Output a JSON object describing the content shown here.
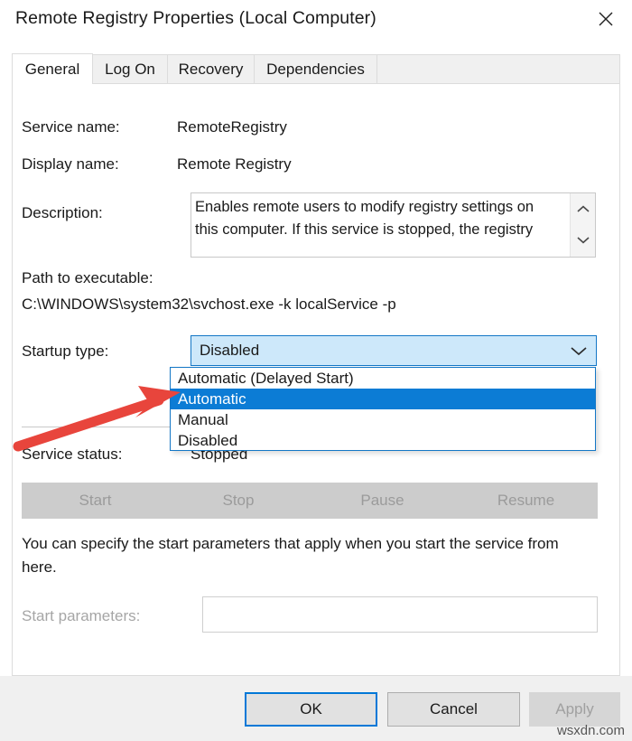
{
  "window": {
    "title": "Remote Registry Properties (Local Computer)",
    "close_icon": "close-icon"
  },
  "tabs": [
    {
      "label": "General",
      "active": true
    },
    {
      "label": "Log On",
      "active": false
    },
    {
      "label": "Recovery",
      "active": false
    },
    {
      "label": "Dependencies",
      "active": false
    }
  ],
  "general": {
    "service_name_label": "Service name:",
    "service_name_value": "RemoteRegistry",
    "display_name_label": "Display name:",
    "display_name_value": "Remote Registry",
    "description_label": "Description:",
    "description_value": "Enables remote users to modify registry settings on this computer. If this service is stopped, the registry",
    "path_label": "Path to executable:",
    "path_value": "C:\\WINDOWS\\system32\\svchost.exe -k localService -p",
    "startup_type_label": "Startup type:",
    "startup_type_value": "Disabled",
    "startup_type_options": [
      "Automatic (Delayed Start)",
      "Automatic",
      "Manual",
      "Disabled"
    ],
    "startup_type_highlighted": "Automatic",
    "service_status_label": "Service status:",
    "service_status_value": "Stopped",
    "control_buttons": [
      {
        "label": "Start",
        "enabled": false
      },
      {
        "label": "Stop",
        "enabled": false
      },
      {
        "label": "Pause",
        "enabled": false
      },
      {
        "label": "Resume",
        "enabled": false
      }
    ],
    "help_text": "You can specify the start parameters that apply when you start the service from here.",
    "start_parameters_label": "Start parameters:",
    "start_parameters_value": "",
    "start_parameters_placeholder": ""
  },
  "footer": {
    "ok_label": "OK",
    "cancel_label": "Cancel",
    "apply_label": "Apply",
    "apply_enabled": false
  },
  "annotation": {
    "arrow_color": "#e8453c",
    "watermark": "wsxdn.com"
  },
  "colors": {
    "accent": "#0078d7",
    "combo_fill": "#cde8fa",
    "highlight": "#0c7cd5",
    "dialog_bg": "#f0f0f0"
  }
}
